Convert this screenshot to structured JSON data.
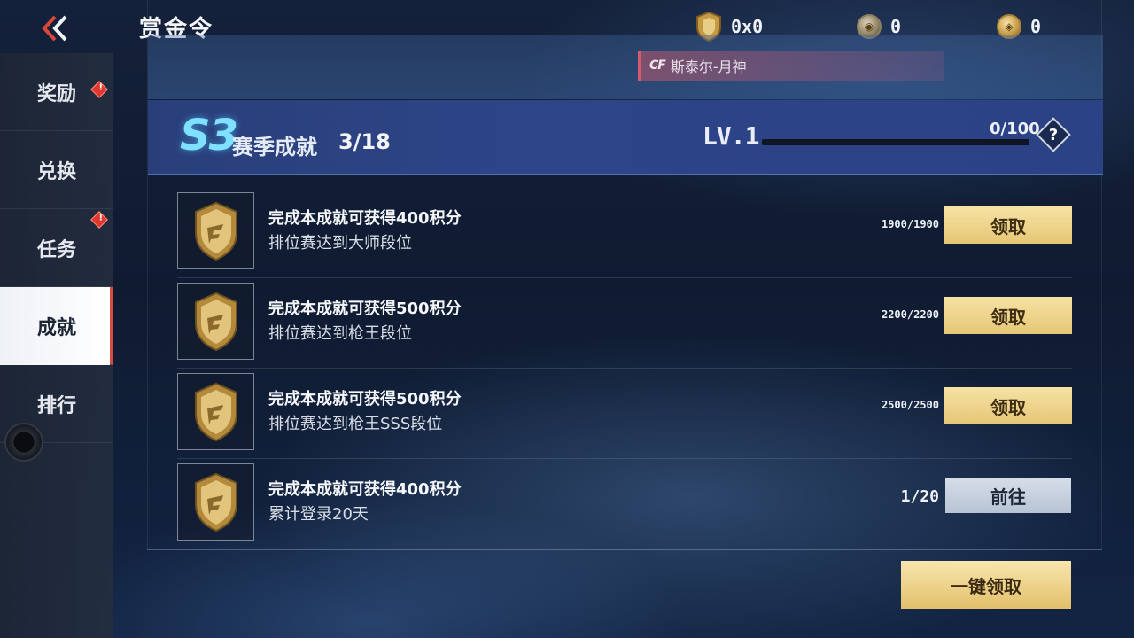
{
  "header": {
    "title": "赏金令",
    "back_icon": "double-chevron-left-icon",
    "currencies": [
      {
        "icon": "shield-medal-icon",
        "value": "0x0"
      },
      {
        "icon": "silver-coin-icon",
        "value": "0"
      },
      {
        "icon": "gold-coin-icon",
        "value": "0"
      }
    ]
  },
  "sidebar": {
    "items": [
      {
        "label": "奖励",
        "alert": "!"
      },
      {
        "label": "兑换",
        "alert": ""
      },
      {
        "label": "任务",
        "alert": "!"
      },
      {
        "label": "成就",
        "alert": ""
      },
      {
        "label": "排行",
        "alert": ""
      }
    ],
    "active": "成就"
  },
  "banner": {
    "name_tag": "斯泰尔-月神",
    "name_tag_logo": "CF"
  },
  "season": {
    "code": "S3",
    "label": "赛季成就",
    "count": "3/18",
    "level": "LV.1",
    "xp": "0/100",
    "xp_fraction": 0,
    "help": "?"
  },
  "achievements": [
    {
      "title": "完成本成就可获得400积分",
      "desc": "排位赛达到大师段位",
      "progress": "1900/1900",
      "action": "领取"
    },
    {
      "title": "完成本成就可获得500积分",
      "desc": "排位赛达到枪王段位",
      "progress": "2200/2200",
      "action": "领取"
    },
    {
      "title": "完成本成就可获得500积分",
      "desc": "排位赛达到枪王SSS段位",
      "progress": "2500/2500",
      "action": "领取"
    },
    {
      "title": "完成本成就可获得400积分",
      "desc": "累计登录20天",
      "progress": "1/20",
      "action": "前往"
    }
  ],
  "claim_all": "一键领取",
  "colors": {
    "accent_gold": "#e6c676",
    "alert_red": "#e0382d",
    "season_blue": "#2d4588"
  }
}
